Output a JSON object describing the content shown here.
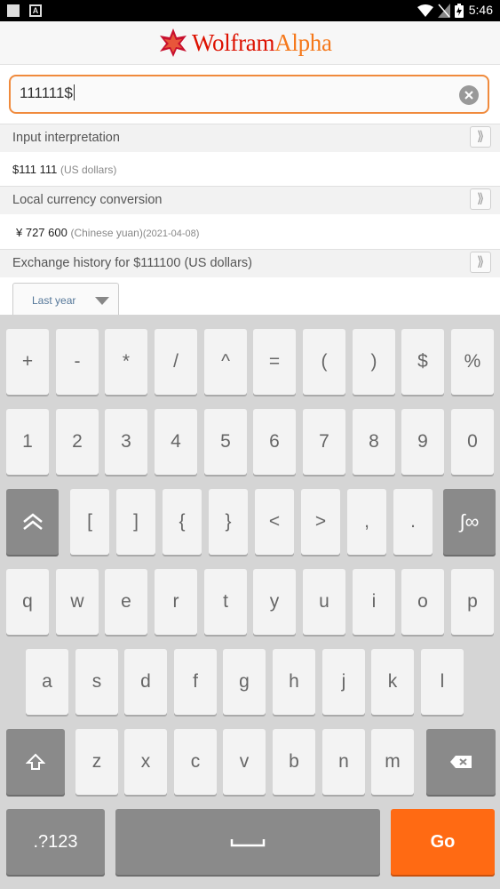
{
  "status_bar": {
    "time": "5:46"
  },
  "app": {
    "logo_text_1": "Wolfram",
    "logo_text_2": "Alpha"
  },
  "search": {
    "value": "111111$"
  },
  "pods": [
    {
      "title": "Input interpretation",
      "amount": "$111 111",
      "unit": "(US dollars)"
    },
    {
      "title": "Local currency conversion",
      "amount": "¥ 727 600",
      "unit": "(Chinese yuan)",
      "date": "(2021-04-08)"
    },
    {
      "title": "Exchange history for $111100 (US dollars)"
    }
  ],
  "pod_expand_label": "⟫",
  "history_dropdown": {
    "selected": "Last year"
  },
  "keyboard": {
    "row1": [
      "+",
      "-",
      "*",
      "/",
      "^",
      "=",
      "(",
      ")",
      "$",
      "%"
    ],
    "row2": [
      "1",
      "2",
      "3",
      "4",
      "5",
      "6",
      "7",
      "8",
      "9",
      "0"
    ],
    "row3": [
      "[",
      "]",
      "{",
      "}",
      "<",
      ">",
      ",",
      "."
    ],
    "row3_special": "∫∞",
    "row4": [
      "q",
      "w",
      "e",
      "r",
      "t",
      "y",
      "u",
      "i",
      "o",
      "p"
    ],
    "row5": [
      "a",
      "s",
      "d",
      "f",
      "g",
      "h",
      "j",
      "k",
      "l"
    ],
    "row6": [
      "z",
      "x",
      "c",
      "v",
      "b",
      "n",
      "m"
    ],
    "mode_key": ".?123",
    "go_key": "Go"
  },
  "colors": {
    "brand_red": "#dd1100",
    "brand_orange": "#f5781a",
    "go_key": "#ff6a13",
    "search_border": "#f08a3c"
  }
}
